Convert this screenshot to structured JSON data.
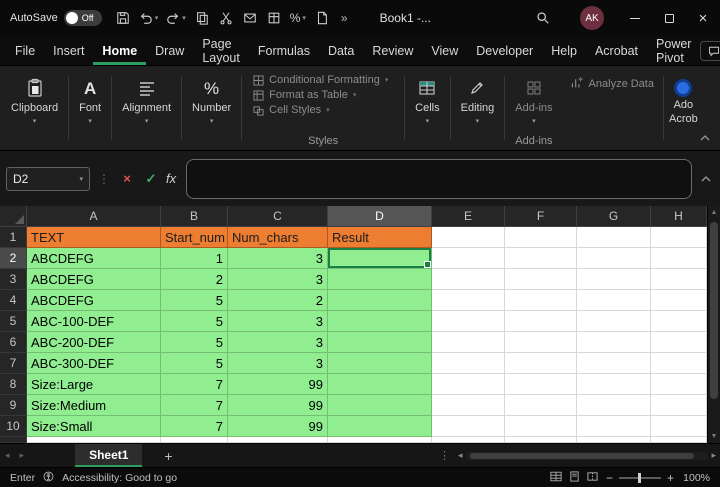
{
  "colors": {
    "accent": "#2E9E5E",
    "header_fill": "#ED7D31",
    "data_fill": "#90EE90",
    "selection": "#1A7F47",
    "avatar": "#6D3040",
    "share_button": "#1E7A44"
  },
  "titlebar": {
    "autosave_label": "AutoSave",
    "autosave_state": "Off",
    "workbook_title": "Book1 -...",
    "avatar": "AK",
    "overflow": "»"
  },
  "menu": {
    "items": [
      "File",
      "Insert",
      "Home",
      "Draw",
      "Page Layout",
      "Formulas",
      "Data",
      "Review",
      "View",
      "Developer",
      "Help",
      "Acrobat",
      "Power Pivot"
    ],
    "active": "Home"
  },
  "ribbon": {
    "collapsed_groups": [
      "Clipboard",
      "Font",
      "Alignment",
      "Number"
    ],
    "styles_items": [
      "Conditional Formatting",
      "Format as Table",
      "Cell Styles"
    ],
    "styles_label": "Styles",
    "cells_label": "Cells",
    "editing_label": "Editing",
    "addins_button": "Add-ins",
    "addins_group_label": "Add-ins",
    "analyze_label": "Analyze Data",
    "acrobat_line1": "Ado",
    "acrobat_line2": "Acrob"
  },
  "formula_bar": {
    "name_box": "D2",
    "fx": "fx",
    "value": ""
  },
  "grid": {
    "columns": [
      "A",
      "B",
      "C",
      "D",
      "E",
      "F",
      "G",
      "H"
    ],
    "selected_column": "D",
    "selected_row": 2,
    "selected_cell": "D2",
    "rows": [
      {
        "n": 1,
        "A": "TEXT",
        "B": "Start_num",
        "C": "Num_chars",
        "D": "Result",
        "style": "header"
      },
      {
        "n": 2,
        "A": "ABCDEFG",
        "B": "1",
        "C": "3",
        "D": "",
        "style": "data"
      },
      {
        "n": 3,
        "A": "ABCDEFG",
        "B": "2",
        "C": "3",
        "D": "",
        "style": "data"
      },
      {
        "n": 4,
        "A": "ABCDEFG",
        "B": "5",
        "C": "2",
        "D": "",
        "style": "data"
      },
      {
        "n": 5,
        "A": "ABC-100-DEF",
        "B": "5",
        "C": "3",
        "D": "",
        "style": "data"
      },
      {
        "n": 6,
        "A": "ABC-200-DEF",
        "B": "5",
        "C": "3",
        "D": "",
        "style": "data"
      },
      {
        "n": 7,
        "A": "ABC-300-DEF",
        "B": "5",
        "C": "3",
        "D": "",
        "style": "data"
      },
      {
        "n": 8,
        "A": "Size:Large",
        "B": "7",
        "C": "99",
        "D": "",
        "style": "data"
      },
      {
        "n": 9,
        "A": "Size:Medium",
        "B": "7",
        "C": "99",
        "D": "",
        "style": "data"
      },
      {
        "n": 10,
        "A": "Size:Small",
        "B": "7",
        "C": "99",
        "D": "",
        "style": "data"
      }
    ]
  },
  "sheet_bar": {
    "active_tab": "Sheet1",
    "add_button": "+"
  },
  "status_bar": {
    "mode": "Enter",
    "accessibility": "Accessibility: Good to go",
    "zoom": "100%"
  }
}
